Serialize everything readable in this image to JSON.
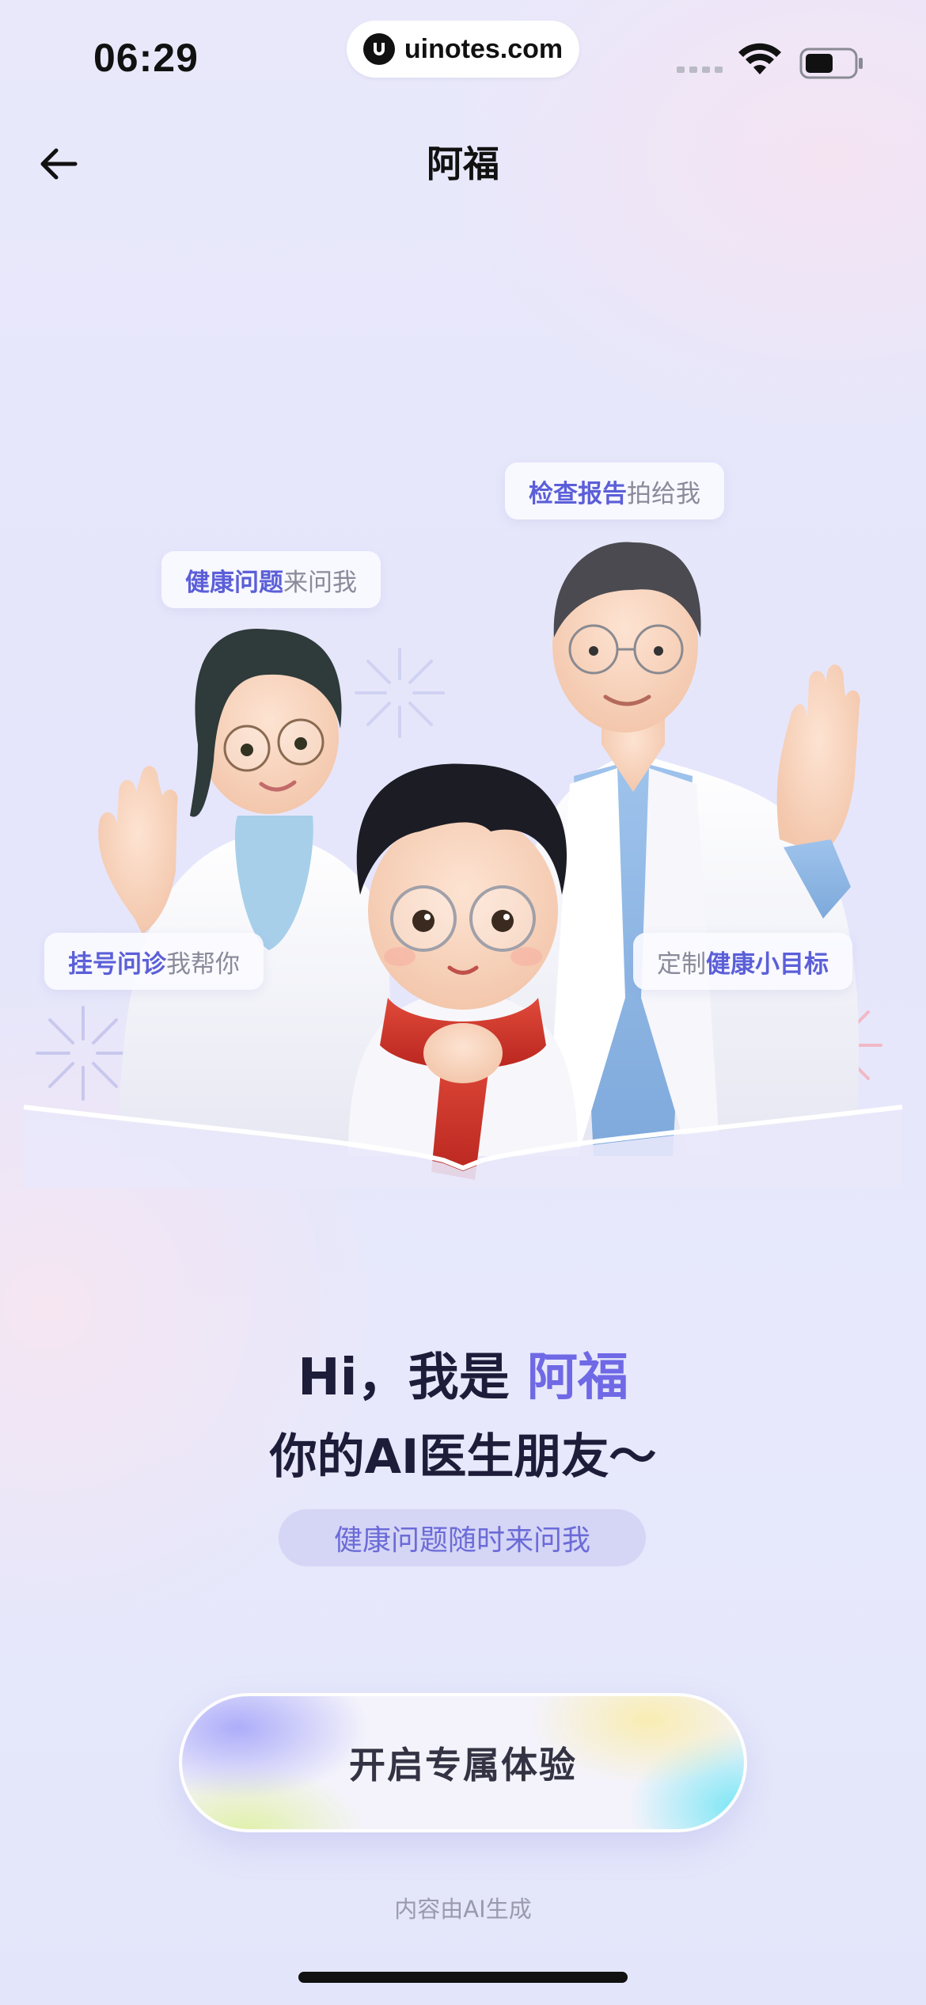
{
  "status_bar": {
    "time": "06:29",
    "url": "uinotes.com"
  },
  "nav": {
    "title": "阿福",
    "back_icon": "arrow-left-icon"
  },
  "hero": {
    "bubbles": {
      "report": {
        "highlight": "检查报告",
        "rest": "拍给我"
      },
      "health": {
        "highlight": "健康问题",
        "rest": "来问我"
      },
      "booking": {
        "highlight": "挂号问诊",
        "rest": "我帮你"
      },
      "goal": {
        "prefix": "定制",
        "highlight": "健康小目标"
      }
    },
    "characters": [
      "female-doctor-illustration",
      "child-mascot-illustration",
      "male-doctor-illustration"
    ]
  },
  "headline": {
    "line1_prefix": "Hi，我是 ",
    "line1_name": "阿福",
    "line2": "你的AI医生朋友～",
    "tag": "健康问题随时来问我"
  },
  "cta": {
    "label": "开启专属体验"
  },
  "footnote": "内容由AI生成",
  "colors": {
    "accent": "#5b5fd8",
    "name_highlight": "#6f69e6",
    "tag_bg": "#d5d5f6",
    "text_dark": "#1d1d3a"
  }
}
